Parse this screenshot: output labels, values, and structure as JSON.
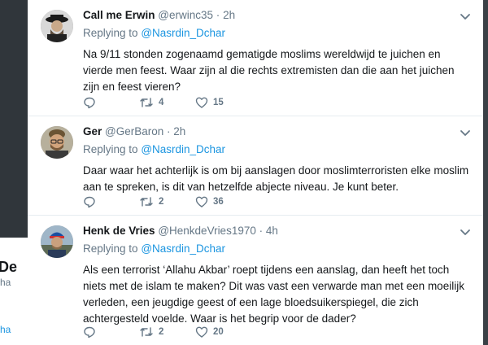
{
  "background": {
    "left_snippet_title": "De",
    "left_snippet_sub": "ha",
    "left_snippet_link": "ha"
  },
  "tweets": [
    {
      "name": "Call me Erwin",
      "handle": "@erwinc35",
      "separator": "·",
      "time": "2h",
      "reply_prefix": "Replying to",
      "reply_to": "@Nasrdin_Dchar",
      "text": "Na 9/11 stonden zogenaamd gematigde moslims wereldwijd te juichen en vierde men feest. Waar zijn al die rechts extremisten dan die aan het juichen zijn en feest vieren?",
      "retweets": "4",
      "likes": "15"
    },
    {
      "name": "Ger",
      "handle": "@GerBaron",
      "separator": "·",
      "time": "2h",
      "reply_prefix": "Replying to",
      "reply_to": "@Nasrdin_Dchar",
      "text": "Daar waar het achterlijk is om bij aanslagen door moslimterroristen elke moslim aan te spreken, is dit van hetzelfde abjecte niveau. Je kunt beter.",
      "retweets": "2",
      "likes": "36"
    },
    {
      "name": "Henk de Vries",
      "handle": "@HenkdeVries1970",
      "separator": "·",
      "time": "4h",
      "reply_prefix": "Replying to",
      "reply_to": "@Nasrdin_Dchar",
      "text": "Als een terrorist ‘Allahu Akbar’ roept tijdens een aanslag, dan heeft het toch niets met de islam te maken? Dit was vast een verwarde man met een moeilijk verleden, een jeugdige geest of een lage bloedsuikerspiegel, die zich achtergesteld voelde. Waar is het begrip voor de dader?",
      "retweets": "2",
      "likes": "20"
    }
  ],
  "icons": {
    "reply": "reply-icon",
    "retweet": "retweet-icon",
    "like": "heart-icon",
    "more": "chevron-down-icon"
  },
  "colors": {
    "link": "#1b95e0",
    "muted": "#657786"
  }
}
